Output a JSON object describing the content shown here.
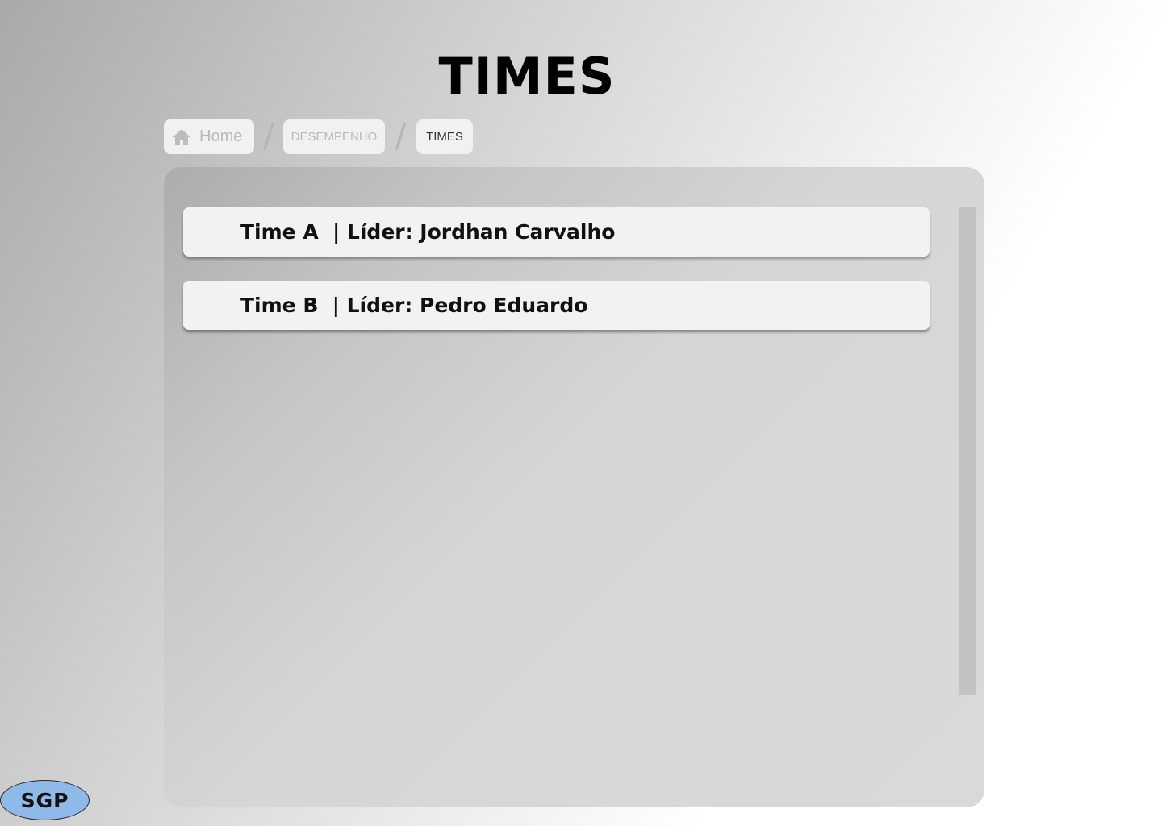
{
  "header": {
    "title": "TIMES"
  },
  "breadcrumb": {
    "home_label": "Home",
    "separator": "/",
    "items": [
      {
        "label": "DESEMPENHO"
      },
      {
        "label": "TIMES"
      }
    ]
  },
  "teams": [
    {
      "label": "Time A  | Líder: Jordhan Carvalho"
    },
    {
      "label": "Time B  | Líder: Pedro Eduardo"
    }
  ],
  "logo": {
    "text": "SGP"
  },
  "icons": {
    "home": "home-icon"
  },
  "colors": {
    "logo_fill": "#8fb9e9",
    "card_background": "#f2f1f4",
    "crumb_background": "#f1f1f1"
  }
}
